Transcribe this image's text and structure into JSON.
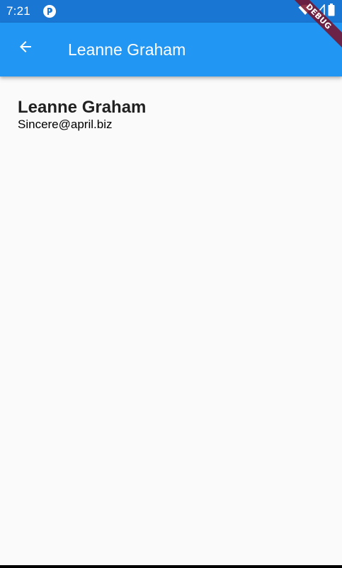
{
  "status_bar": {
    "time": "7:21",
    "app_icon": "notification-app-icon",
    "wifi_icon": "wifi-icon",
    "signal_icon": "cell-signal-icon",
    "battery_icon": "battery-icon"
  },
  "app_bar": {
    "back_icon": "arrow-back-icon",
    "title": "Leanne Graham"
  },
  "debug_banner": {
    "label": "DEBUG"
  },
  "user": {
    "name": "Leanne Graham",
    "email": "Sincere@april.biz"
  },
  "colors": {
    "status_bar": "#1976d2",
    "app_bar": "#2196f3",
    "background": "#fafafa",
    "debug_ribbon": "#781028"
  }
}
